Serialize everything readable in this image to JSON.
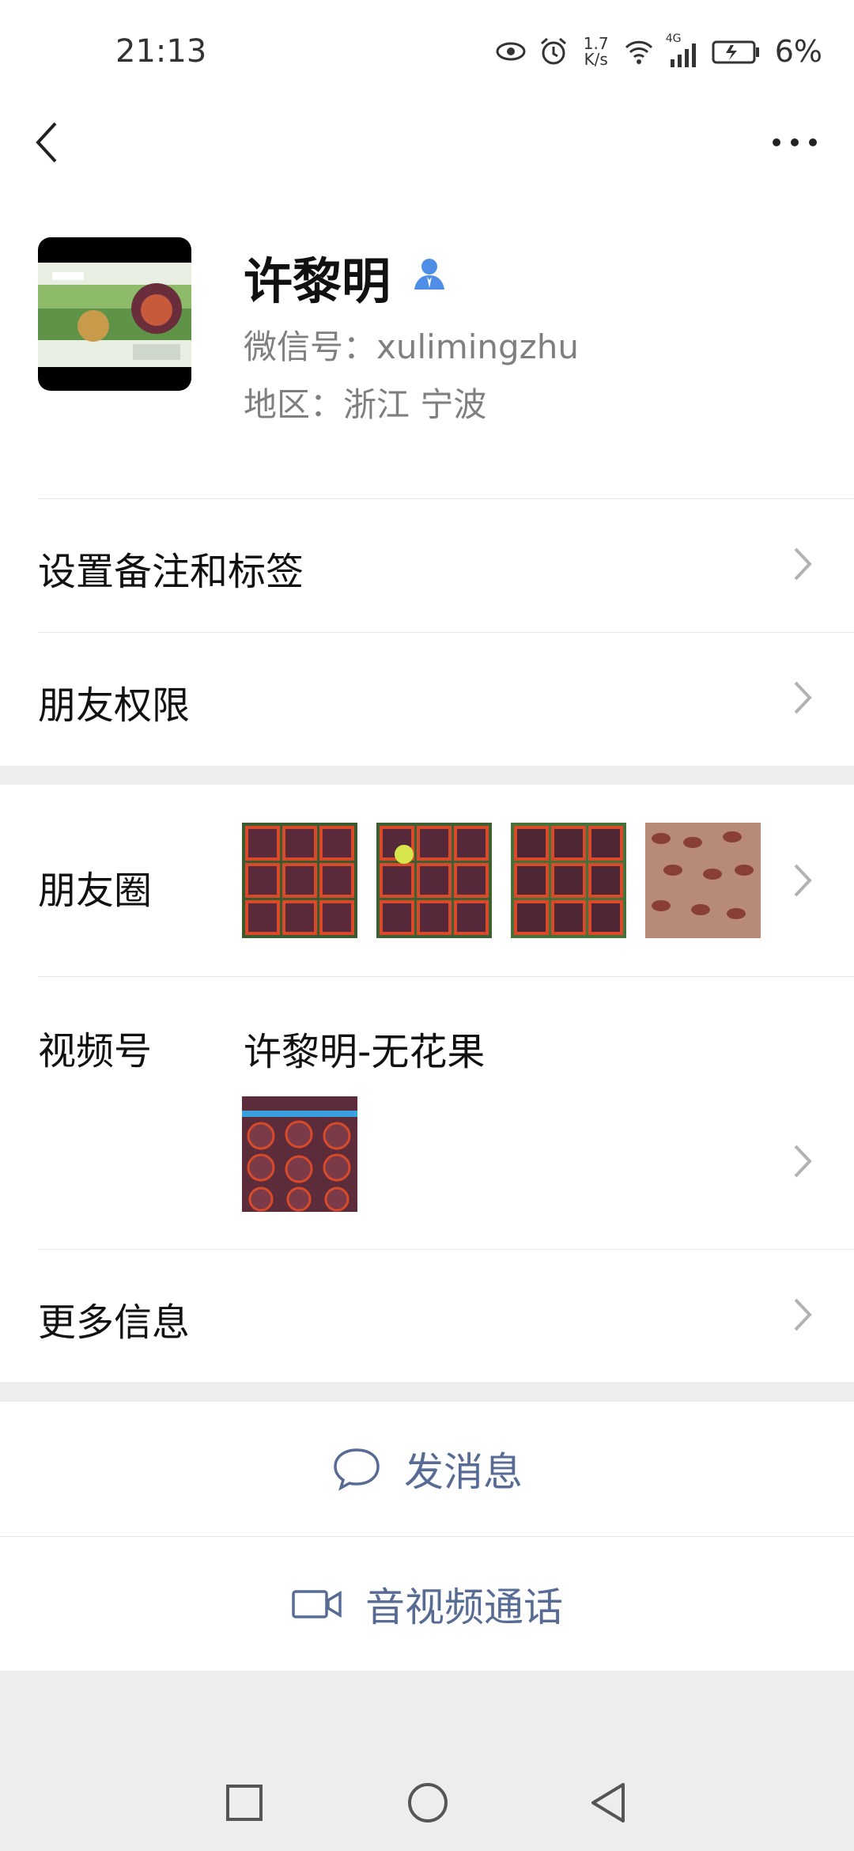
{
  "status_bar": {
    "time": "21:13",
    "net_speed_value": "1.7",
    "net_speed_unit": "K/s",
    "network_type": "4G",
    "battery": "6%",
    "icons": [
      "eye-icon",
      "alarm-icon",
      "wifi-icon",
      "signal-icon",
      "battery-icon"
    ]
  },
  "profile": {
    "name": "许黎明",
    "wechat_id": "微信号：xulimingzhu",
    "region": "地区：浙江  宁波"
  },
  "menu": {
    "remark_tags": "设置备注和标签",
    "friend_permissions": "朋友权限",
    "moments": "朋友圈",
    "channels": "视频号",
    "channel_name": "许黎明-无花果",
    "more_info": "更多信息"
  },
  "actions": {
    "send_message": "发消息",
    "video_call": "音视频通话"
  },
  "colors": {
    "accent_blue": "#576b95",
    "verified_blue": "#4e8ee6",
    "background": "#ededed"
  }
}
